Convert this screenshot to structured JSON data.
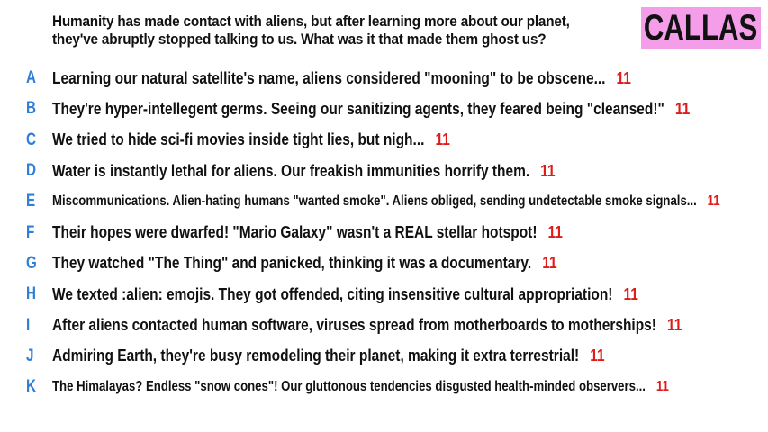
{
  "prompt": {
    "line1": "Humanity has made contact with aliens, but after learning more about our planet,",
    "line2": "they've abruptly stopped talking to us. What was it that made them ghost us?"
  },
  "logo": "CALLAS",
  "colors": {
    "letter": "#2f7fd8",
    "score": "#e01919",
    "logo_bg": "#f49ee9"
  },
  "answers": [
    {
      "letter": "A",
      "text": "Learning our natural satellite's name, aliens considered \"mooning\" to be obscene...",
      "score": "11"
    },
    {
      "letter": "B",
      "text": "They're hyper-intellegent germs. Seeing our sanitizing agents, they feared being \"cleansed!\"",
      "score": "11"
    },
    {
      "letter": "C",
      "text": "We tried to hide sci-fi movies inside tight lies, but nigh...",
      "score": "11"
    },
    {
      "letter": "D",
      "text": "Water is instantly lethal for aliens. Our freakish immunities horrify them.",
      "score": "11"
    },
    {
      "letter": "E",
      "text": "Miscommunications. Alien-hating humans \"wanted smoke\". Aliens obliged, sending undetectable smoke signals...",
      "score": "11"
    },
    {
      "letter": "F",
      "text": "Their hopes were dwarfed! \"Mario Galaxy\" wasn't a REAL stellar hotspot!",
      "score": "11"
    },
    {
      "letter": "G",
      "text": "They watched \"The Thing\" and panicked, thinking it was a documentary.",
      "score": "11"
    },
    {
      "letter": "H",
      "text": "We texted :alien: emojis. They got offended, citing insensitive cultural appropriation!",
      "score": "11"
    },
    {
      "letter": "I",
      "text": "After aliens contacted human software, viruses spread from motherboards to motherships!",
      "score": "11"
    },
    {
      "letter": "J",
      "text": "Admiring Earth, they're busy remodeling their planet, making it extra terrestrial!",
      "score": "11"
    },
    {
      "letter": "K",
      "text": "The Himalayas? Endless \"snow cones\"! Our gluttonous tendencies disgusted health-minded observers...",
      "score": "11"
    }
  ]
}
